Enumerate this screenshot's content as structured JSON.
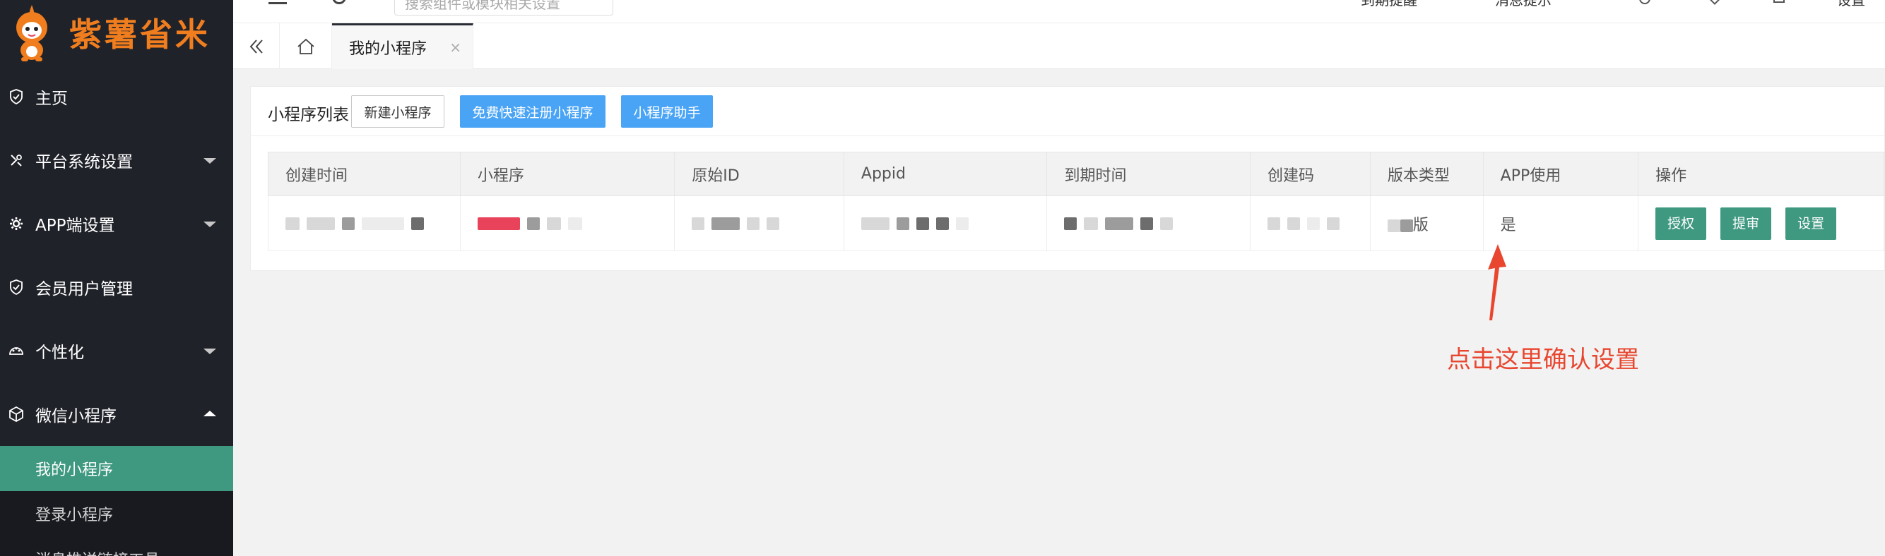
{
  "brand": {
    "name": "紫薯省米",
    "color": "#f07e1f"
  },
  "sidebar": {
    "items": [
      {
        "label": "主页",
        "icon": "shield-icon",
        "expandable": false
      },
      {
        "label": "平台系统设置",
        "icon": "tools-icon",
        "expandable": true
      },
      {
        "label": "APP端设置",
        "icon": "gear-icon",
        "expandable": true
      },
      {
        "label": "会员用户管理",
        "icon": "shield-icon",
        "expandable": false
      },
      {
        "label": "个性化",
        "icon": "palette-icon",
        "expandable": true
      },
      {
        "label": "微信小程序",
        "icon": "cube-icon",
        "expandable": true,
        "expanded": true
      }
    ],
    "subitems": [
      {
        "label": "我的小程序",
        "active": true
      },
      {
        "label": "登录小程序",
        "active": false
      },
      {
        "label": "消息推送链接工具",
        "active": false
      }
    ]
  },
  "topbar": {
    "search_placeholder": "搜索组件或模块相关设置",
    "right_items": [
      "到期提醒",
      "消息提示",
      "",
      "",
      "",
      "设置"
    ]
  },
  "tabs": {
    "active_label": "我的小程序",
    "close_symbol": "×"
  },
  "page": {
    "title": "小程序列表",
    "buttons": {
      "new": "新建小程序",
      "quick_register": "免费快速注册小程序",
      "assistant": "小程序助手"
    }
  },
  "table": {
    "columns": [
      "创建时间",
      "小程序",
      "原始ID",
      "Appid",
      "到期时间",
      "创建码",
      "版本类型",
      "APP使用",
      "操作"
    ],
    "rows": [
      {
        "version_suffix": "版",
        "app_use": "是",
        "actions": [
          "授权",
          "提审",
          "设置"
        ]
      }
    ]
  },
  "annotation": {
    "text": "点击这里确认设置",
    "color": "#e8462f"
  },
  "colors": {
    "sidebar_bg": "#20222a",
    "active_green": "#3f9880",
    "blue_button": "#4aa4f5"
  }
}
